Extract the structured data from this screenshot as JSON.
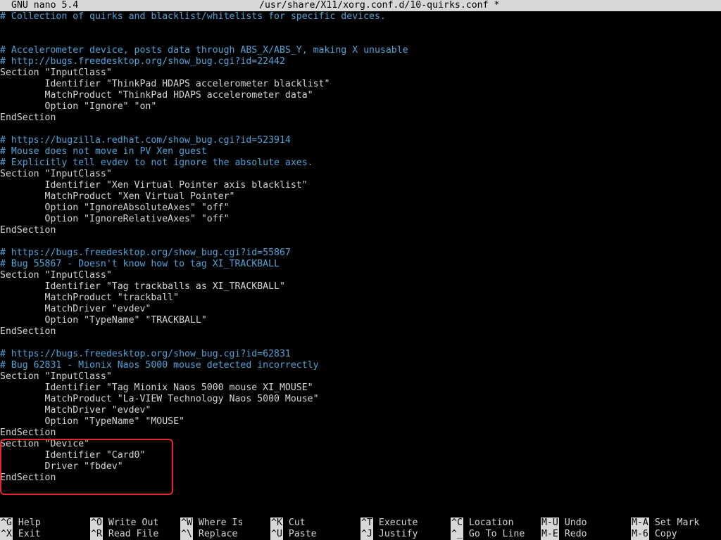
{
  "titlebar": {
    "app": "GNU nano 5.4",
    "file": "/usr/share/X11/xorg.conf.d/10-quirks.conf *"
  },
  "editor": {
    "lines": [
      {
        "type": "comment",
        "text": "# Collection of quirks and blacklist/whitelists for specific devices."
      },
      {
        "type": "code",
        "text": ""
      },
      {
        "type": "code",
        "text": ""
      },
      {
        "type": "comment",
        "text": "# Accelerometer device, posts data through ABS_X/ABS_Y, making X unusable"
      },
      {
        "type": "comment",
        "text": "# http://bugs.freedesktop.org/show_bug.cgi?id=22442"
      },
      {
        "type": "code",
        "text": "Section \"InputClass\""
      },
      {
        "type": "code",
        "text": "        Identifier \"ThinkPad HDAPS accelerometer blacklist\""
      },
      {
        "type": "code",
        "text": "        MatchProduct \"ThinkPad HDAPS accelerometer data\""
      },
      {
        "type": "code",
        "text": "        Option \"Ignore\" \"on\""
      },
      {
        "type": "code",
        "text": "EndSection"
      },
      {
        "type": "code",
        "text": ""
      },
      {
        "type": "comment",
        "text": "# https://bugzilla.redhat.com/show_bug.cgi?id=523914"
      },
      {
        "type": "comment",
        "text": "# Mouse does not move in PV Xen guest"
      },
      {
        "type": "comment",
        "text": "# Explicitly tell evdev to not ignore the absolute axes."
      },
      {
        "type": "code",
        "text": "Section \"InputClass\""
      },
      {
        "type": "code",
        "text": "        Identifier \"Xen Virtual Pointer axis blacklist\""
      },
      {
        "type": "code",
        "text": "        MatchProduct \"Xen Virtual Pointer\""
      },
      {
        "type": "code",
        "text": "        Option \"IgnoreAbsoluteAxes\" \"off\""
      },
      {
        "type": "code",
        "text": "        Option \"IgnoreRelativeAxes\" \"off\""
      },
      {
        "type": "code",
        "text": "EndSection"
      },
      {
        "type": "code",
        "text": ""
      },
      {
        "type": "comment",
        "text": "# https://bugs.freedesktop.org/show_bug.cgi?id=55867"
      },
      {
        "type": "comment",
        "text": "# Bug 55867 - Doesn't know how to tag XI_TRACKBALL"
      },
      {
        "type": "code",
        "text": "Section \"InputClass\""
      },
      {
        "type": "code",
        "text": "        Identifier \"Tag trackballs as XI_TRACKBALL\""
      },
      {
        "type": "code",
        "text": "        MatchProduct \"trackball\""
      },
      {
        "type": "code",
        "text": "        MatchDriver \"evdev\""
      },
      {
        "type": "code",
        "text": "        Option \"TypeName\" \"TRACKBALL\""
      },
      {
        "type": "code",
        "text": "EndSection"
      },
      {
        "type": "code",
        "text": ""
      },
      {
        "type": "comment",
        "text": "# https://bugs.freedesktop.org/show_bug.cgi?id=62831"
      },
      {
        "type": "comment",
        "text": "# Bug 62831 - Mionix Naos 5000 mouse detected incorrectly"
      },
      {
        "type": "code",
        "text": "Section \"InputClass\""
      },
      {
        "type": "code",
        "text": "        Identifier \"Tag Mionix Naos 5000 mouse XI_MOUSE\""
      },
      {
        "type": "code",
        "text": "        MatchProduct \"La-VIEW Technology Naos 5000 Mouse\""
      },
      {
        "type": "code",
        "text": "        MatchDriver \"evdev\""
      },
      {
        "type": "code",
        "text": "        Option \"TypeName\" \"MOUSE\""
      },
      {
        "type": "code",
        "text": "EndSection"
      },
      {
        "type": "code",
        "text": "Section \"Device\""
      },
      {
        "type": "code",
        "text": "        Identifier \"Card0\""
      },
      {
        "type": "code",
        "text": "        Driver \"fbdev\""
      },
      {
        "type": "code",
        "text": "EndSection"
      }
    ]
  },
  "shortcuts": [
    {
      "key": "^G",
      "label": "Help"
    },
    {
      "key": "^X",
      "label": "Exit"
    },
    {
      "key": "^O",
      "label": "Write Out"
    },
    {
      "key": "^R",
      "label": "Read File"
    },
    {
      "key": "^W",
      "label": "Where Is"
    },
    {
      "key": "^\\",
      "label": "Replace"
    },
    {
      "key": "^K",
      "label": "Cut"
    },
    {
      "key": "^U",
      "label": "Paste"
    },
    {
      "key": "^T",
      "label": "Execute"
    },
    {
      "key": "^J",
      "label": "Justify"
    },
    {
      "key": "^C",
      "label": "Location"
    },
    {
      "key": "^_",
      "label": "Go To Line"
    },
    {
      "key": "M-U",
      "label": "Undo"
    },
    {
      "key": "M-E",
      "label": "Redo"
    },
    {
      "key": "M-A",
      "label": "Set Mark"
    },
    {
      "key": "M-6",
      "label": "Copy"
    }
  ],
  "colors": {
    "background": "#000000",
    "text": "#d6d6d6",
    "comment": "#4fa3d6",
    "bar": "#d8d8d8",
    "highlight": "#e5262b"
  }
}
